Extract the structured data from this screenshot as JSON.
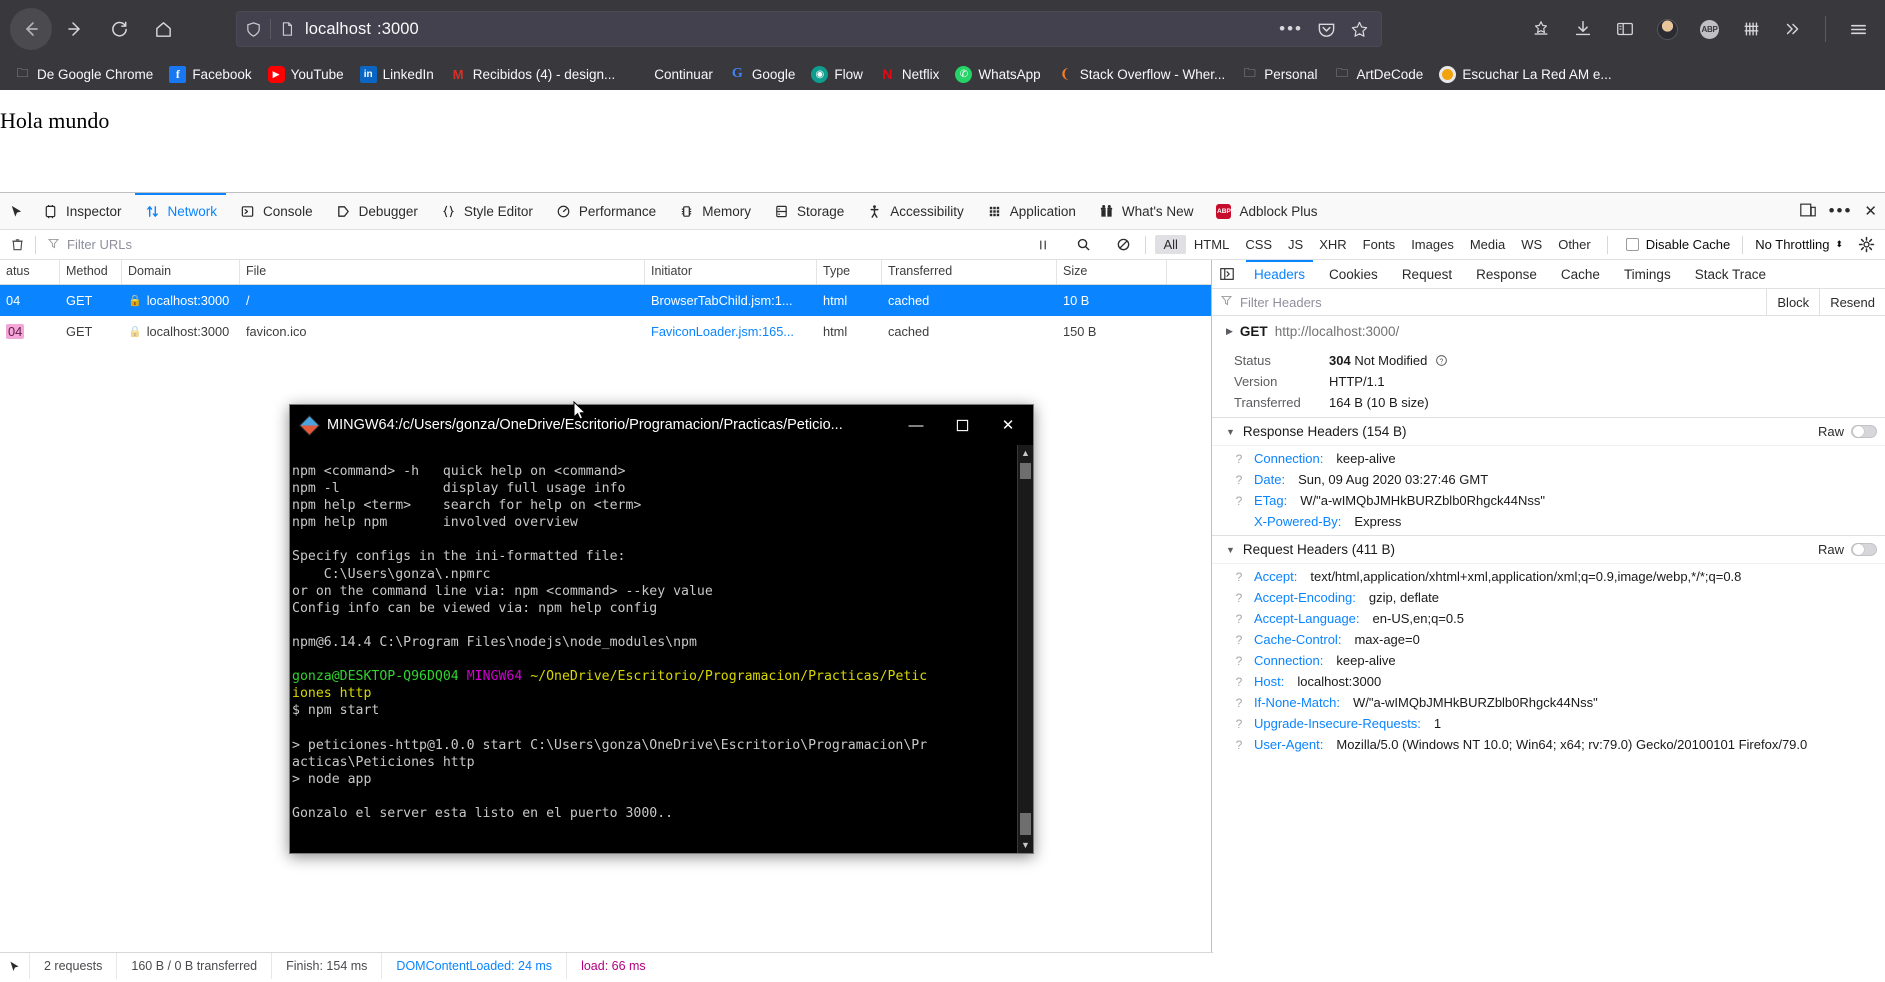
{
  "browser": {
    "url_text": "localhost",
    "url_dim": ":3000",
    "nav": {
      "back": "back-arrow",
      "forward": "forward-arrow",
      "reload": "reload",
      "home": "home"
    },
    "toolbar_icons": [
      "pocket-icon",
      "bookmark-star-icon",
      "downloads-icon",
      "sidebar-icon",
      "account-avatar",
      "adblock-plus-icon",
      "grid-icon",
      "overflow-chevrons-icon",
      "hamburger-menu-icon"
    ],
    "bookmarks": [
      {
        "label": "De Google Chrome",
        "icon": "folder-icon"
      },
      {
        "label": "Facebook",
        "icon": "facebook-icon"
      },
      {
        "label": "YouTube",
        "icon": "youtube-icon"
      },
      {
        "label": "LinkedIn",
        "icon": "linkedin-icon"
      },
      {
        "label": "Recibidos (4) - design...",
        "icon": "gmail-icon"
      },
      {
        "label": "Continuar",
        "icon": "microsoft-icon"
      },
      {
        "label": "Google",
        "icon": "google-icon"
      },
      {
        "label": "Flow",
        "icon": "flow-icon"
      },
      {
        "label": "Netflix",
        "icon": "netflix-icon"
      },
      {
        "label": "WhatsApp",
        "icon": "whatsapp-icon"
      },
      {
        "label": "Stack Overflow - Wher...",
        "icon": "stackoverflow-icon"
      },
      {
        "label": "Personal",
        "icon": "folder-icon"
      },
      {
        "label": "ArtDeCode",
        "icon": "folder-icon"
      },
      {
        "label": "Escuchar La Red AM e...",
        "icon": "radio-icon"
      }
    ]
  },
  "page": {
    "body_text": "Hola mundo"
  },
  "devtools": {
    "tabs": [
      {
        "label": "Inspector",
        "icon": "inspector-icon",
        "active": false
      },
      {
        "label": "Network",
        "icon": "network-icon",
        "active": true
      },
      {
        "label": "Console",
        "icon": "console-icon",
        "active": false
      },
      {
        "label": "Debugger",
        "icon": "debugger-icon",
        "active": false
      },
      {
        "label": "Style Editor",
        "icon": "style-editor-icon",
        "active": false
      },
      {
        "label": "Performance",
        "icon": "performance-icon",
        "active": false
      },
      {
        "label": "Memory",
        "icon": "memory-icon",
        "active": false
      },
      {
        "label": "Storage",
        "icon": "storage-icon",
        "active": false
      },
      {
        "label": "Accessibility",
        "icon": "accessibility-icon",
        "active": false
      },
      {
        "label": "Application",
        "icon": "application-icon",
        "active": false
      },
      {
        "label": "What's New",
        "icon": "whats-new-icon",
        "active": false
      },
      {
        "label": "Adblock Plus",
        "icon": "adblock-plus-icon",
        "active": false
      }
    ],
    "filterbar": {
      "trash_icon": "trash-icon",
      "placeholder": "Filter URLs",
      "pause_icon": "pause-icon",
      "search_icon": "search-icon",
      "block_icon": "block-icon",
      "types": [
        "All",
        "HTML",
        "CSS",
        "JS",
        "XHR",
        "Fonts",
        "Images",
        "Media",
        "WS",
        "Other"
      ],
      "active_type": "All",
      "disable_cache_label": "Disable Cache",
      "disable_cache_checked": false,
      "throttling_value": "No Throttling",
      "settings_icon": "gear-icon"
    },
    "table": {
      "columns": [
        "atus",
        "Method",
        "Domain",
        "File",
        "Initiator",
        "Type",
        "Transferred",
        "Size"
      ],
      "rows": [
        {
          "status": "04",
          "method": "GET",
          "domain": "localhost:3000",
          "file": "/",
          "initiator": "BrowserTabChild.jsm:1...",
          "type": "html",
          "transferred": "cached",
          "size": "10 B",
          "selected": true,
          "secure": true
        },
        {
          "status": "04",
          "method": "GET",
          "domain": "localhost:3000",
          "file": "favicon.ico",
          "initiator": "FaviconLoader.jsm:165...",
          "type": "html",
          "transferred": "cached",
          "size": "150 B",
          "selected": false,
          "secure": true
        }
      ]
    },
    "statusbar": {
      "requests": "2 requests",
      "transferred": "160 B / 0 B transferred",
      "finish": "Finish: 154 ms",
      "domcontentloaded": "DOMContentLoaded: 24 ms",
      "load": "load: 66 ms"
    },
    "details": {
      "tabs": [
        "Headers",
        "Cookies",
        "Request",
        "Response",
        "Cache",
        "Timings",
        "Stack Trace"
      ],
      "active_tab": "Headers",
      "expand_icon": "expand-pane-icon",
      "filter_placeholder": "Filter Headers",
      "actions": [
        "Block",
        "Resend"
      ],
      "request_line": {
        "method": "GET",
        "url": "http://localhost:3000/"
      },
      "summary": [
        {
          "key": "Status",
          "code": "304",
          "value": "Not Modified",
          "has_help": true
        },
        {
          "key": "Version",
          "value": "HTTP/1.1"
        },
        {
          "key": "Transferred",
          "value": "164 B (10 B size)"
        }
      ],
      "response_headers": {
        "title": "Response Headers (154 B)",
        "raw_label": "Raw",
        "items": [
          {
            "name": "Connection:",
            "value": "keep-alive",
            "help": true
          },
          {
            "name": "Date:",
            "value": "Sun, 09 Aug 2020 03:27:46 GMT",
            "help": true
          },
          {
            "name": "ETag:",
            "value": "W/\"a-wIMQbJMHkBURZblb0Rhgck44Nss\"",
            "help": true
          },
          {
            "name": "X-Powered-By:",
            "value": "Express",
            "help": false
          }
        ]
      },
      "request_headers": {
        "title": "Request Headers (411 B)",
        "raw_label": "Raw",
        "items": [
          {
            "name": "Accept:",
            "value": "text/html,application/xhtml+xml,application/xml;q=0.9,image/webp,*/*;q=0.8",
            "help": true
          },
          {
            "name": "Accept-Encoding:",
            "value": "gzip, deflate",
            "help": true
          },
          {
            "name": "Accept-Language:",
            "value": "en-US,en;q=0.5",
            "help": true
          },
          {
            "name": "Cache-Control:",
            "value": "max-age=0",
            "help": true
          },
          {
            "name": "Connection:",
            "value": "keep-alive",
            "help": true
          },
          {
            "name": "Host:",
            "value": "localhost:3000",
            "help": true
          },
          {
            "name": "If-None-Match:",
            "value": "W/\"a-wIMQbJMHkBURZblb0Rhgck44Nss\"",
            "help": true
          },
          {
            "name": "Upgrade-Insecure-Requests:",
            "value": "1",
            "help": true
          },
          {
            "name": "User-Agent:",
            "value": "Mozilla/5.0 (Windows NT 10.0; Win64; x64; rv:79.0) Gecko/20100101 Firefox/79.0",
            "help": true
          }
        ]
      }
    }
  },
  "terminal": {
    "title": "MINGW64:/c/Users/gonza/OneDrive/Escritorio/Programacion/Practicas/Peticio...",
    "icon": "mingw-diamond-icon",
    "window_buttons": {
      "minimize": "—",
      "maximize": "☐",
      "close": "✕"
    },
    "lines": [
      "npm <command> -h   quick help on <command>",
      "npm -l             display full usage info",
      "npm help <term>    search for help on <term>",
      "npm help npm       involved overview",
      "",
      "Specify configs in the ini-formatted file:",
      "    C:\\Users\\gonza\\.npmrc",
      "or on the command line via: npm <command> --key value",
      "Config info can be viewed via: npm help config",
      "",
      "npm@6.14.4 C:\\Program Files\\nodejs\\node_modules\\npm",
      ""
    ],
    "prompt_user": "gonza@DESKTOP-Q96DQ04",
    "prompt_shell": "MINGW64",
    "prompt_path": "~/OneDrive/Escritorio/Programacion/Practicas/Petic",
    "prompt_path_wrap": "iones http",
    "command": "$ npm start",
    "lines2": [
      "",
      "> peticiones-http@1.0.0 start C:\\Users\\gonza\\OneDrive\\Escritorio\\Programacion\\Pr",
      "acticas\\Peticiones http",
      "> node app",
      "",
      "Gonzalo el server esta listo en el puerto 3000.."
    ]
  },
  "colors": {
    "accent": "#0a84ff",
    "chrome_bg": "#38383d",
    "selected_row": "#0a84ff",
    "terminal_green": "#2fd42f",
    "terminal_magenta": "#d000d0",
    "terminal_yellow": "#d7d700"
  }
}
